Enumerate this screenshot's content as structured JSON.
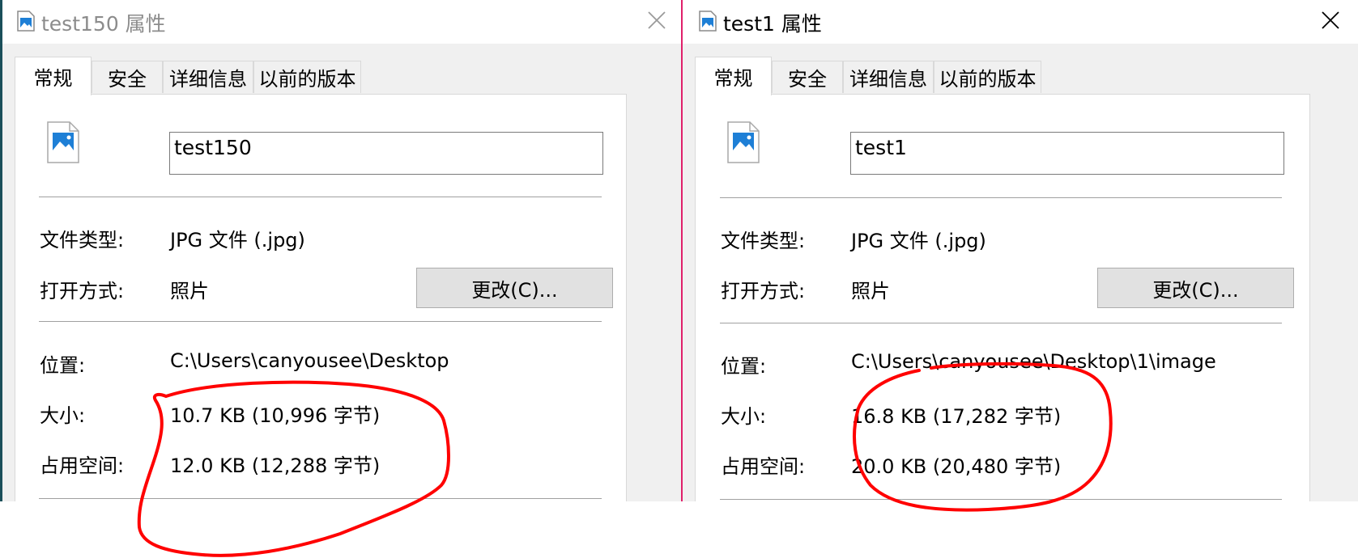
{
  "dialogs": [
    {
      "title": "test150 属性",
      "tabs": [
        "常规",
        "安全",
        "详细信息",
        "以前的版本"
      ],
      "filename": "test150",
      "fields": {
        "type_label": "文件类型:",
        "type_value": "JPG 文件 (.jpg)",
        "open_label": "打开方式:",
        "open_value": "照片",
        "change_button": "更改(C)...",
        "location_label": "位置:",
        "location_value": "C:\\Users\\canyousee\\Desktop",
        "size_label": "大小:",
        "size_value": "10.7 KB (10,996 字节)",
        "disk_label": "占用空间:",
        "disk_value": "12.0 KB (12,288 字节)"
      }
    },
    {
      "title": "test1 属性",
      "tabs": [
        "常规",
        "安全",
        "详细信息",
        "以前的版本"
      ],
      "filename": "test1",
      "fields": {
        "type_label": "文件类型:",
        "type_value": "JPG 文件 (.jpg)",
        "open_label": "打开方式:",
        "open_value": "照片",
        "change_button": "更改(C)...",
        "location_label": "位置:",
        "location_value": "C:\\Users\\canyousee\\Desktop\\1\\image",
        "size_label": "大小:",
        "size_value": "16.8 KB (17,282 字节)",
        "disk_label": "占用空间:",
        "disk_value": "20.0 KB (20,480 字节)"
      }
    }
  ],
  "icons": {
    "title": "image-file-icon",
    "close": "close-icon",
    "file": "jpg-file-icon"
  },
  "colors": {
    "annotation": "#ff0000",
    "dialog_bg": "#f0f0f0",
    "panel_bg": "#ffffff",
    "button_bg": "#e1e1e1",
    "inactive_title": "#8c8c8c"
  }
}
